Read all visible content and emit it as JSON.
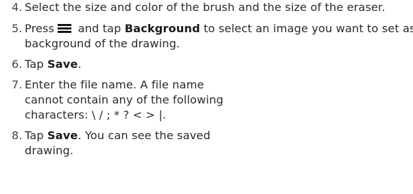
{
  "steps": [
    {
      "number": "4.",
      "text": "Select the size and color of the brush and the size of the eraser."
    },
    {
      "number": "5.",
      "before_icon": "Press ",
      "icon": "menu-icon",
      "middle": " and tap ",
      "bold": "Background",
      "after_bold": " to select an image you want to set as background of the drawing."
    },
    {
      "number": "6.",
      "before_bold": "Tap ",
      "bold": "Save",
      "after_bold": "."
    },
    {
      "number": "7.",
      "text": "Enter the file name. A file name cannot contain any of the following characters: \\ / ; * ? < > |."
    },
    {
      "number": "8.",
      "before_bold": "Tap ",
      "bold": "Save",
      "after_bold": ". You can see the saved drawing."
    }
  ]
}
